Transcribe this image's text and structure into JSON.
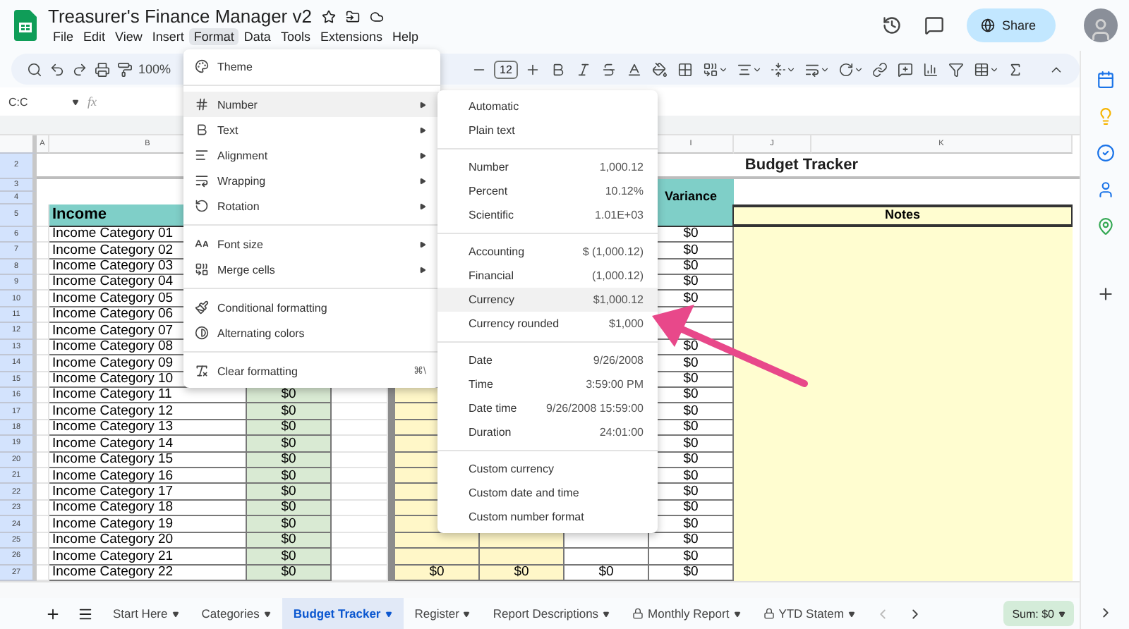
{
  "document": {
    "title": "Treasurer's Finance Manager v2"
  },
  "menu_bar": [
    {
      "label": "File",
      "selected": false
    },
    {
      "label": "Edit",
      "selected": false
    },
    {
      "label": "View",
      "selected": false
    },
    {
      "label": "Insert",
      "selected": false
    },
    {
      "label": "Format",
      "selected": true
    },
    {
      "label": "Data",
      "selected": false
    },
    {
      "label": "Tools",
      "selected": false
    },
    {
      "label": "Extensions",
      "selected": false
    },
    {
      "label": "Help",
      "selected": false
    }
  ],
  "share_button": "Share",
  "toolbar": {
    "zoom": "100%",
    "font_size": "12"
  },
  "formula_bar": {
    "name_box": "C:C",
    "fx": "fx"
  },
  "column_headers": {
    "a": "A",
    "b": "B",
    "i": "I",
    "j": "J",
    "k": "K"
  },
  "rows": [
    {
      "n": "2",
      "kind": "title",
      "title": "Budget Tracker"
    },
    {
      "n": "3",
      "kind": "blank"
    },
    {
      "n": "4",
      "kind": "blank",
      "i": "Variance"
    },
    {
      "n": "5",
      "kind": "header",
      "b": "Income",
      "notes": "Notes"
    },
    {
      "n": "6",
      "kind": "data",
      "b": "Income Category 01",
      "i": "$0"
    },
    {
      "n": "7",
      "kind": "data",
      "b": "Income Category 02",
      "i": "$0"
    },
    {
      "n": "8",
      "kind": "data",
      "b": "Income Category 03",
      "i": "$0"
    },
    {
      "n": "9",
      "kind": "data",
      "b": "Income Category 04",
      "i": "$0"
    },
    {
      "n": "10",
      "kind": "data",
      "b": "Income Category 05",
      "i": "$0"
    },
    {
      "n": "11",
      "kind": "data",
      "b": "Income Category 06"
    },
    {
      "n": "12",
      "kind": "data",
      "b": "Income Category 07"
    },
    {
      "n": "13",
      "kind": "data",
      "b": "Income Category 08",
      "i": "$0"
    },
    {
      "n": "14",
      "kind": "data",
      "b": "Income Category 09",
      "i": "$0"
    },
    {
      "n": "15",
      "kind": "data",
      "b": "Income Category 10",
      "i": "$0"
    },
    {
      "n": "16",
      "kind": "data",
      "b": "Income Category 11",
      "c": "$0",
      "i": "$0"
    },
    {
      "n": "17",
      "kind": "data",
      "b": "Income Category 12",
      "c": "$0",
      "i": "$0"
    },
    {
      "n": "18",
      "kind": "data",
      "b": "Income Category 13",
      "c": "$0",
      "i": "$0"
    },
    {
      "n": "19",
      "kind": "data",
      "b": "Income Category 14",
      "c": "$0",
      "i": "$0"
    },
    {
      "n": "20",
      "kind": "data",
      "b": "Income Category 15",
      "c": "$0",
      "i": "$0"
    },
    {
      "n": "21",
      "kind": "data",
      "b": "Income Category 16",
      "c": "$0",
      "i": "$0"
    },
    {
      "n": "22",
      "kind": "data",
      "b": "Income Category 17",
      "c": "$0",
      "i": "$0"
    },
    {
      "n": "23",
      "kind": "data",
      "b": "Income Category 18",
      "c": "$0",
      "i": "$0"
    },
    {
      "n": "24",
      "kind": "data",
      "b": "Income Category 19",
      "c": "$0",
      "i": "$0"
    },
    {
      "n": "25",
      "kind": "data",
      "b": "Income Category 20",
      "c": "$0",
      "i": "$0"
    },
    {
      "n": "26",
      "kind": "data",
      "b": "Income Category 21",
      "c": "$0",
      "i": "$0"
    },
    {
      "n": "27",
      "kind": "data",
      "b": "Income Category 22",
      "c": "$0",
      "f": "$0",
      "g": "$0",
      "h": "$0",
      "i": "$0"
    }
  ],
  "format_menu": [
    [
      {
        "label": "Theme",
        "submenu": false,
        "highlighted": false
      }
    ],
    [
      {
        "label": "Number",
        "submenu": true,
        "highlighted": true
      },
      {
        "label": "Text",
        "submenu": true,
        "highlighted": false
      },
      {
        "label": "Alignment",
        "submenu": true,
        "highlighted": false
      },
      {
        "label": "Wrapping",
        "submenu": true,
        "highlighted": false
      },
      {
        "label": "Rotation",
        "submenu": true,
        "highlighted": false
      }
    ],
    [
      {
        "label": "Font size",
        "submenu": true,
        "highlighted": false
      },
      {
        "label": "Merge cells",
        "submenu": true,
        "highlighted": false
      }
    ],
    [
      {
        "label": "Conditional formatting",
        "submenu": false,
        "highlighted": false
      },
      {
        "label": "Alternating colors",
        "submenu": false,
        "highlighted": false
      }
    ],
    [
      {
        "label": "Clear formatting",
        "submenu": false,
        "highlighted": false,
        "shortcut": "⌘\\"
      }
    ]
  ],
  "number_submenu": [
    [
      {
        "label": "Automatic",
        "highlighted": false
      },
      {
        "label": "Plain text",
        "highlighted": false
      }
    ],
    [
      {
        "label": "Number",
        "example": "1,000.12",
        "highlighted": false
      },
      {
        "label": "Percent",
        "example": "10.12%",
        "highlighted": false
      },
      {
        "label": "Scientific",
        "example": "1.01E+03",
        "highlighted": false
      }
    ],
    [
      {
        "label": "Accounting",
        "example": "$ (1,000.12)",
        "highlighted": false
      },
      {
        "label": "Financial",
        "example": "(1,000.12)",
        "highlighted": false
      },
      {
        "label": "Currency",
        "example": "$1,000.12",
        "highlighted": true
      },
      {
        "label": "Currency rounded",
        "example": "$1,000",
        "highlighted": false
      }
    ],
    [
      {
        "label": "Date",
        "example": "9/26/2008",
        "highlighted": false
      },
      {
        "label": "Time",
        "example": "3:59:00 PM",
        "highlighted": false
      },
      {
        "label": "Date time",
        "example": "9/26/2008 15:59:00",
        "highlighted": false
      },
      {
        "label": "Duration",
        "example": "24:01:00",
        "highlighted": false
      }
    ],
    [
      {
        "label": "Custom currency",
        "highlighted": false
      },
      {
        "label": "Custom date and time",
        "highlighted": false
      },
      {
        "label": "Custom number format",
        "highlighted": false
      }
    ]
  ],
  "sheet_tabs": [
    {
      "label": "Start Here",
      "selected": false,
      "locked": false
    },
    {
      "label": "Categories",
      "selected": false,
      "locked": false
    },
    {
      "label": "Budget Tracker",
      "selected": true,
      "locked": false
    },
    {
      "label": "Register",
      "selected": false,
      "locked": false
    },
    {
      "label": "Report Descriptions",
      "selected": false,
      "locked": false
    },
    {
      "label": "Monthly Report",
      "selected": false,
      "locked": true
    },
    {
      "label": "YTD Statem",
      "selected": false,
      "locked": true
    }
  ],
  "sum_button": "Sum: $0"
}
